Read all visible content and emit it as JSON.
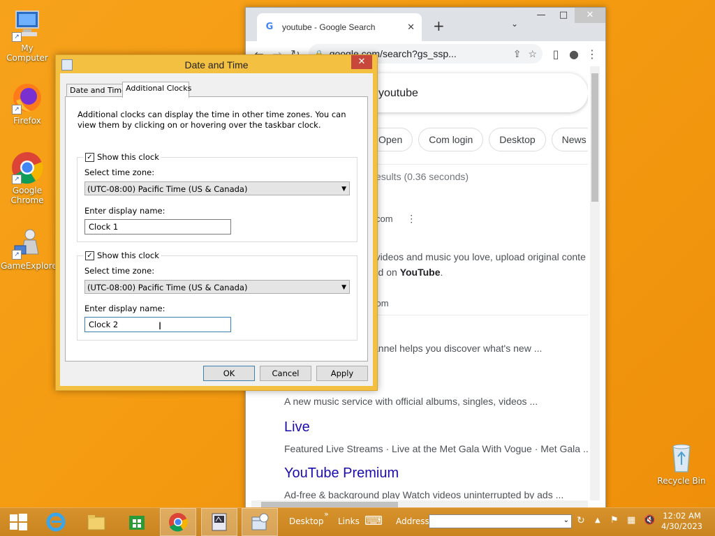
{
  "desktop": {
    "icons": [
      {
        "label": "My Computer"
      },
      {
        "label": "Firefox"
      },
      {
        "label": "Google Chrome"
      },
      {
        "label": "GameExplorer"
      },
      {
        "label": "Recycle Bin"
      }
    ]
  },
  "chrome": {
    "tab_title": "youtube - Google Search",
    "url": "google.com/search?gs_ssp...",
    "search_query": "youtube",
    "chips": [
      "Open",
      "Com login",
      "Desktop",
      "News"
    ],
    "results_stat": "esults (0.36 seconds)",
    "site_fragment": "com",
    "desc_line1": "e videos and music you love, upload original conte",
    "desc_line2_prefix": "orld on ",
    "desc_line2_bold": "YouTube",
    "desc_line2_suffix": ".",
    "url_fragment2": "com",
    "snippet1": "annel helps you discover what's new ...",
    "snippet2": "A new music service with official albums, singles, videos ...",
    "title_live": "Live",
    "snippet_live": "Featured Live Streams · Live at the Met Gala With Vogue · Met Gala ...",
    "title_premium": "YouTube Premium",
    "snippet_premium": "Ad-free & background play Watch videos uninterrupted by ads ..."
  },
  "dialog": {
    "title": "Date and Time",
    "tabs": [
      "Date and Time",
      "Additional Clocks"
    ],
    "intro": "Additional clocks can display the time in other time zones. You can view them by clicking on or hovering over the taskbar clock.",
    "clock1": {
      "show_label": "Show this clock",
      "tz_label": "Select time zone:",
      "tz_value": "(UTC-08:00) Pacific Time (US & Canada)",
      "name_label": "Enter display name:",
      "name_value": "Clock 1"
    },
    "clock2": {
      "show_label": "Show this clock",
      "tz_label": "Select time zone:",
      "tz_value": "(UTC-08:00) Pacific Time (US & Canada)",
      "name_label": "Enter display name:",
      "name_value": "Clock 2"
    },
    "buttons": {
      "ok": "OK",
      "cancel": "Cancel",
      "apply": "Apply"
    }
  },
  "taskbar": {
    "toolbar_desktop": "Desktop",
    "toolbar_links": "Links",
    "toolbar_address": "Address",
    "time": "12:02 AM",
    "date": "4/30/2023"
  }
}
